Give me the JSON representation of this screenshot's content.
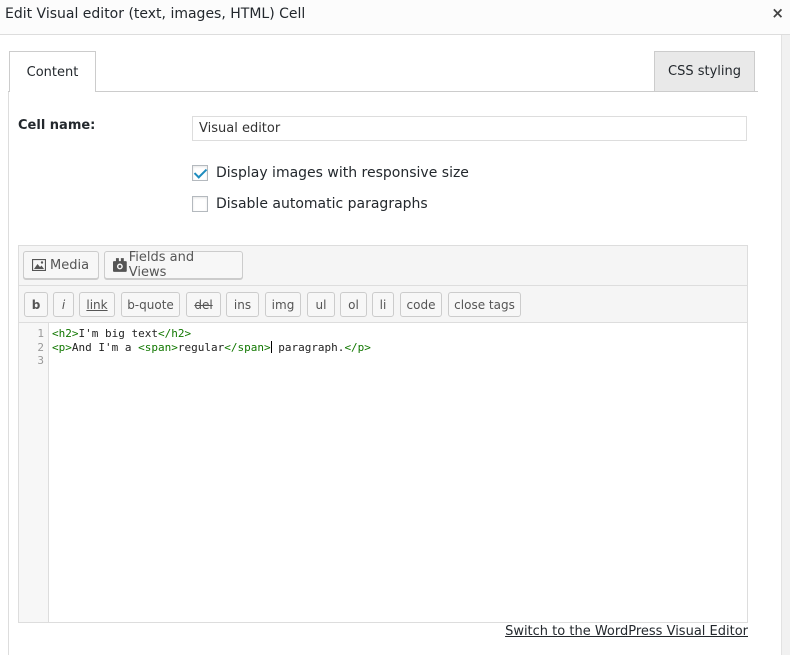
{
  "dialog": {
    "title": "Edit Visual editor (text, images, HTML) Cell",
    "close_glyph": "×"
  },
  "tabs": [
    {
      "label": "Content"
    },
    {
      "label": "CSS styling"
    }
  ],
  "form": {
    "cell_name_label": "Cell name:",
    "cell_name_value": "Visual editor",
    "options": [
      {
        "label": "Display images with responsive size",
        "checked": true
      },
      {
        "label": "Disable automatic paragraphs",
        "checked": false
      }
    ]
  },
  "editor": {
    "media_label": "Media",
    "fields_label": "Fields and Views",
    "quicktags": [
      "b",
      "i",
      "link",
      "b-quote",
      "del",
      "ins",
      "img",
      "ul",
      "ol",
      "li",
      "code",
      "close tags"
    ],
    "line_numbers": [
      "1",
      "2",
      "3"
    ],
    "line1": {
      "open": "<h2>",
      "text": "I'm big text",
      "close": "</h2>"
    },
    "line2": {
      "p_open": "<p>",
      "text1": "And I'm a ",
      "span_open": "<span>",
      "text2": "regular",
      "span_close": "</span>",
      "text3": " paragraph.",
      "p_close": "</p>"
    }
  },
  "footer": {
    "switch_label": "Switch to the WordPress Visual Editor"
  },
  "colors": {
    "accent": "#1e8cbe",
    "tag": "#117700"
  }
}
